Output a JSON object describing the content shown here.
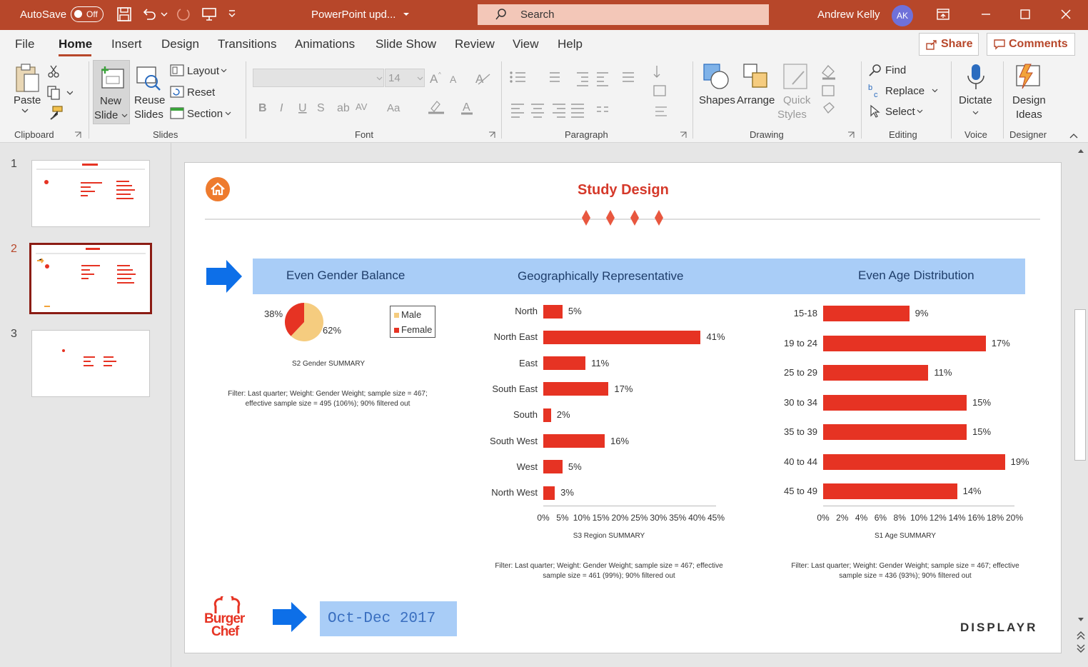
{
  "titlebar": {
    "autosave_label": "AutoSave",
    "autosave_state": "Off",
    "doc_title": "PowerPoint upd...",
    "search_placeholder": "Search",
    "user_name": "Andrew Kelly",
    "user_initials": "AK"
  },
  "menu": {
    "tabs": [
      "File",
      "Home",
      "Insert",
      "Design",
      "Transitions",
      "Animations",
      "Slide Show",
      "Review",
      "View",
      "Help"
    ],
    "active": "Home",
    "share_label": "Share",
    "comments_label": "Comments"
  },
  "ribbon": {
    "clipboard": {
      "paste": "Paste",
      "group": "Clipboard"
    },
    "slides": {
      "new_slide_1": "New",
      "new_slide_2": "Slide",
      "reuse_1": "Reuse",
      "reuse_2": "Slides",
      "layout": "Layout",
      "reset": "Reset",
      "section": "Section",
      "group": "Slides"
    },
    "font": {
      "font_size": "14",
      "group": "Font"
    },
    "paragraph": {
      "group": "Paragraph"
    },
    "drawing": {
      "shapes": "Shapes",
      "arrange": "Arrange",
      "quick_1": "Quick",
      "quick_2": "Styles",
      "group": "Drawing"
    },
    "editing": {
      "find": "Find",
      "replace": "Replace",
      "select": "Select",
      "group": "Editing"
    },
    "voice": {
      "dictate": "Dictate",
      "group": "Voice"
    },
    "designer": {
      "ideas_1": "Design",
      "ideas_2": "Ideas",
      "group": "Designer"
    }
  },
  "thumbnails": [
    "1",
    "2",
    "3"
  ],
  "slide": {
    "title": "Study Design",
    "headers": [
      "Even Gender Balance",
      "Geographically Representative",
      "Even Age Distribution"
    ],
    "gender": {
      "male_pct_label": "62%",
      "female_pct_label": "38%",
      "legend": [
        "Male",
        "Female"
      ],
      "caption": "S2 Gender SUMMARY",
      "filter_1": "Filter: Last quarter; Weight: Gender Weight; sample size = 467;",
      "filter_2": "effective sample size = 495 (106%); 90% filtered out"
    },
    "region_caption": "S3 Region SUMMARY",
    "region_filter_1": "Filter: Last quarter; Weight: Gender Weight; sample size = 467; effective",
    "region_filter_2": "sample size = 461 (99%); 90% filtered out",
    "age_caption": "S1 Age SUMMARY",
    "age_filter_1": "Filter: Last quarter; Weight: Gender Weight; sample size = 467; effective",
    "age_filter_2": "sample size = 436 (93%); 90% filtered out",
    "period": "Oct-Dec 2017",
    "brand_1": "Burger",
    "brand_2": "Chef",
    "displayr": "DISPLAYR"
  },
  "colors": {
    "bar": "#e63323",
    "accent": "#b7472a",
    "header_band": "#a9cdf7",
    "male": "#f5cc7f",
    "arrow": "#0d6fe8"
  },
  "chart_data": [
    {
      "type": "pie",
      "categories": [
        "Male",
        "Female"
      ],
      "values": [
        62,
        38
      ],
      "title": "Even Gender Balance"
    },
    {
      "type": "bar",
      "orientation": "horizontal",
      "title": "Geographically Representative",
      "categories": [
        "North",
        "North East",
        "East",
        "South East",
        "South",
        "South West",
        "West",
        "North West"
      ],
      "values": [
        5,
        41,
        11,
        17,
        2,
        16,
        5,
        3
      ],
      "labels": [
        "5%",
        "41%",
        "11%",
        "17%",
        "2%",
        "16%",
        "5%",
        "3%"
      ],
      "xlim": [
        0,
        45
      ],
      "ticks": [
        "0%",
        "5%",
        "10%",
        "15%",
        "20%",
        "25%",
        "30%",
        "35%",
        "40%",
        "45%"
      ],
      "xlabel": "S3 Region SUMMARY"
    },
    {
      "type": "bar",
      "orientation": "horizontal",
      "title": "Even Age Distribution",
      "categories": [
        "15-18",
        "19 to 24",
        "25 to 29",
        "30 to 34",
        "35 to 39",
        "40 to 44",
        "45 to 49"
      ],
      "values": [
        9,
        17,
        11,
        15,
        15,
        19,
        14
      ],
      "labels": [
        "9%",
        "17%",
        "11%",
        "15%",
        "15%",
        "19%",
        "14%"
      ],
      "xlim": [
        0,
        20
      ],
      "ticks": [
        "0%",
        "2%",
        "4%",
        "6%",
        "8%",
        "10%",
        "12%",
        "14%",
        "16%",
        "18%",
        "20%"
      ],
      "xlabel": "S1 Age SUMMARY"
    }
  ]
}
